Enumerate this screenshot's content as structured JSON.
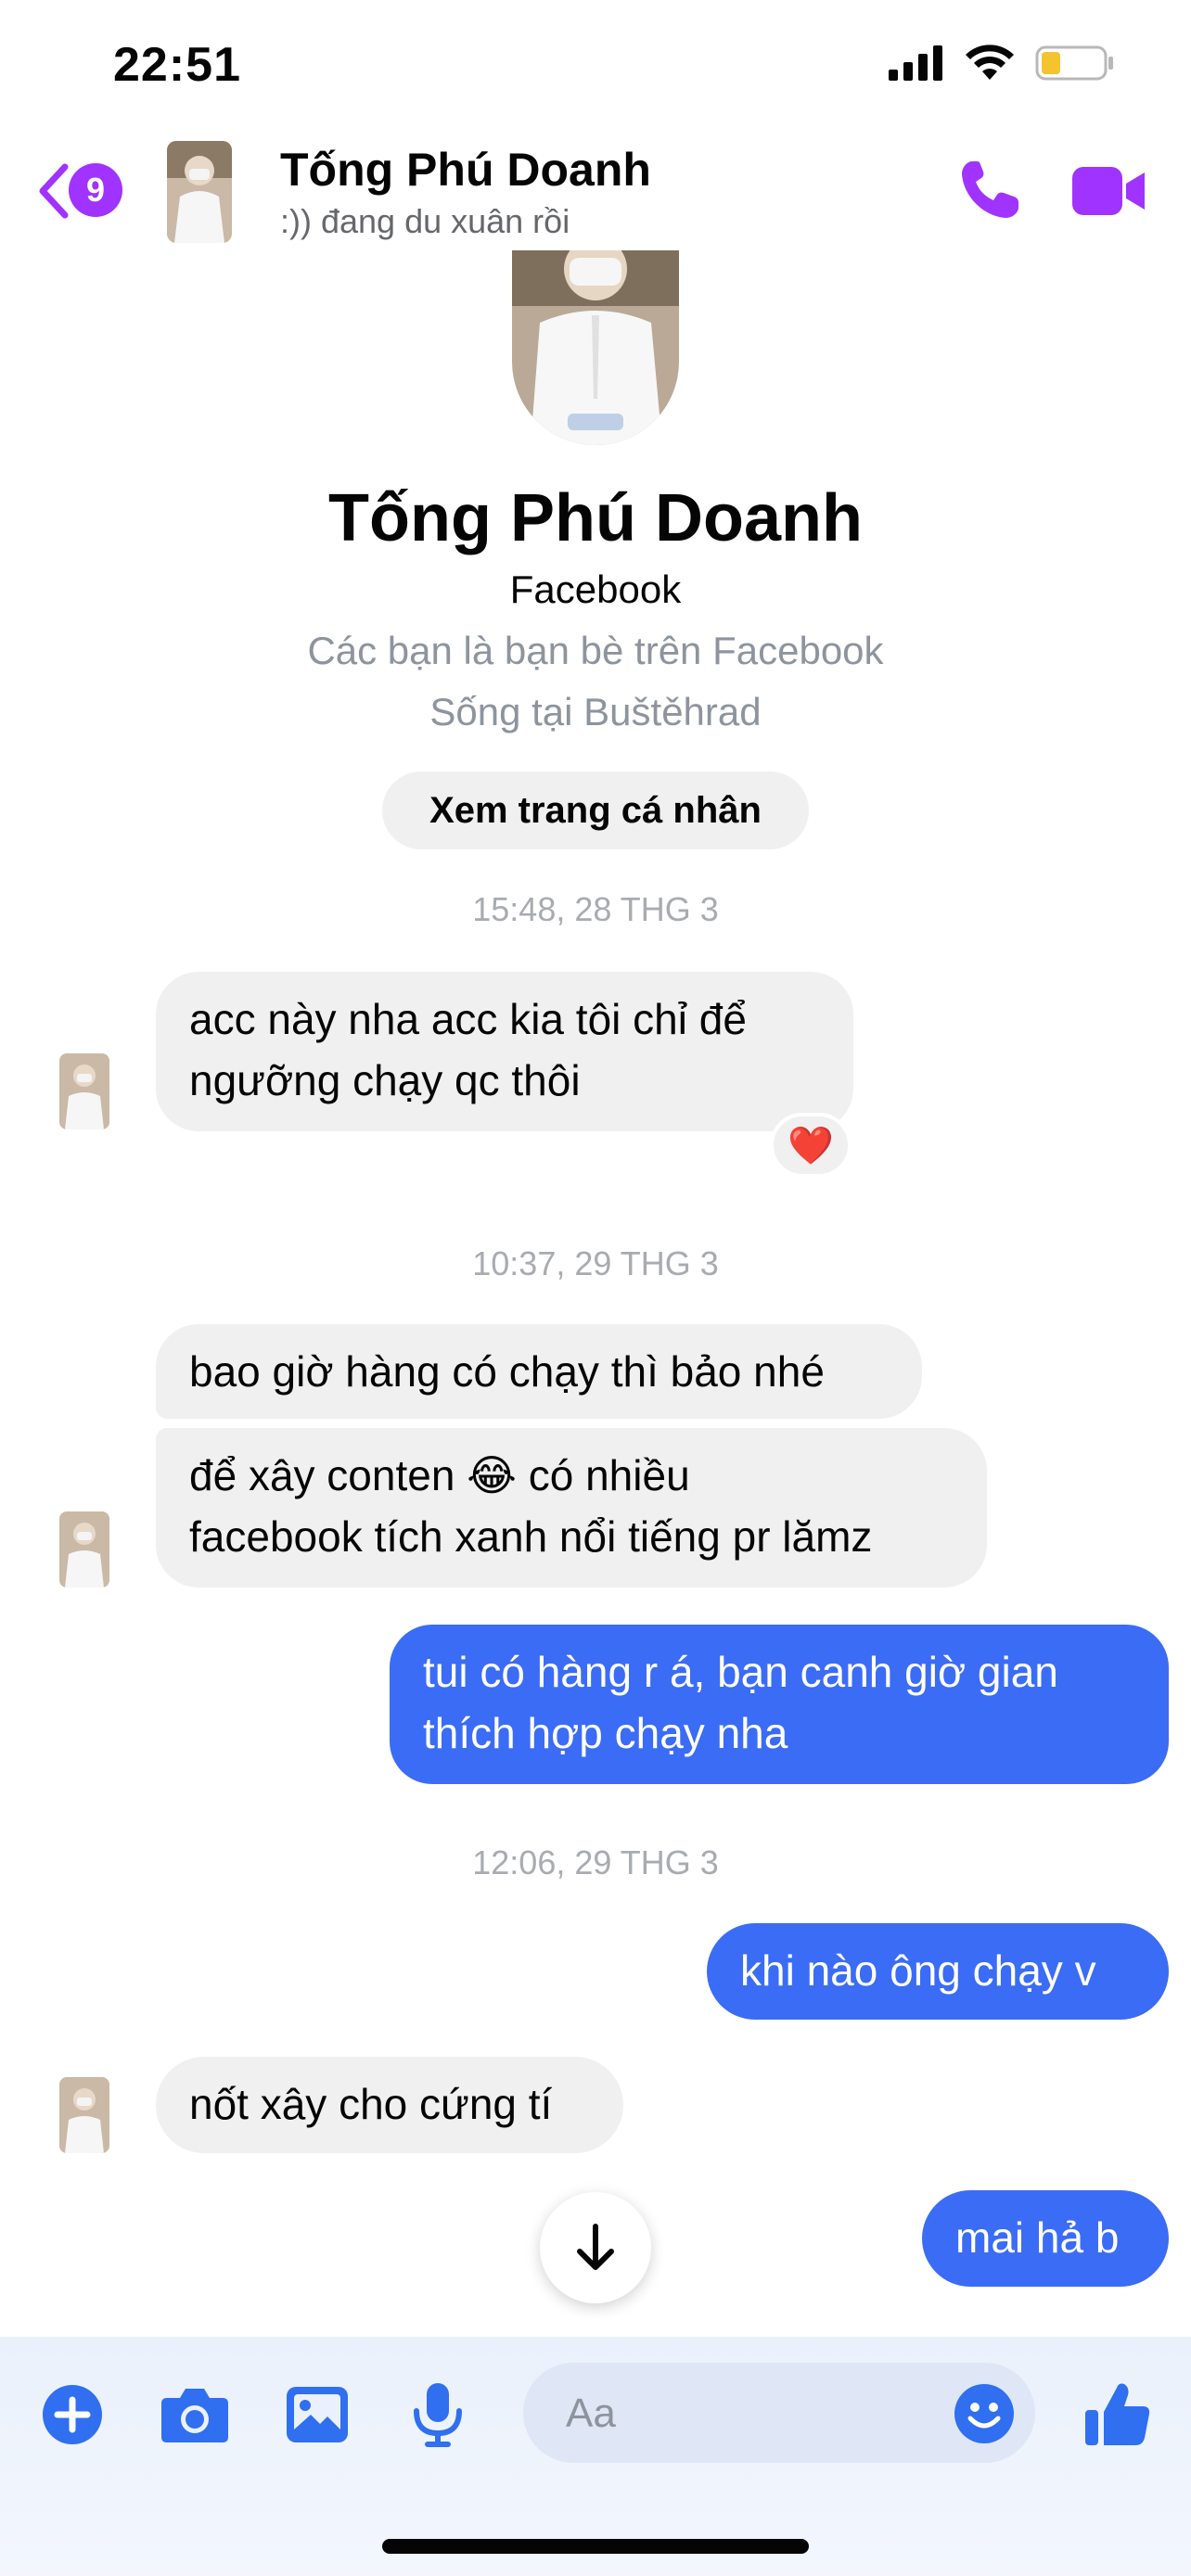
{
  "status_bar": {
    "time": "22:51"
  },
  "header": {
    "back_badge": "9",
    "name": "Tống Phú Doanh",
    "status": ":)) đang du xuân rồi"
  },
  "profile": {
    "name": "Tống Phú Doanh",
    "source": "Facebook",
    "friendship": "Các bạn là bạn bè trên Facebook",
    "location": "Sống tại Buštěhrad",
    "view_profile_label": "Xem trang cá nhân"
  },
  "conversation": {
    "timestamps": [
      "15:48, 28 THG 3",
      "10:37, 29 THG 3",
      "12:06, 29 THG 3"
    ],
    "messages": [
      {
        "sender": "them",
        "lines": [
          "acc này nha acc kia tôi chỉ để",
          "ngưỡng chạy qc thôi"
        ],
        "reaction": "❤️"
      },
      {
        "sender": "them",
        "lines": [
          "bao giờ hàng có chạy thì bảo nhé"
        ]
      },
      {
        "sender": "them",
        "lines": [
          "để xây conten 😂 có nhiều",
          "facebook tích xanh nổi tiếng pr lămz"
        ]
      },
      {
        "sender": "me",
        "lines": [
          "tui có hàng r á, bạn canh giờ gian",
          "thích hợp chạy nha"
        ]
      },
      {
        "sender": "me",
        "lines": [
          "khi nào ông chạy v"
        ]
      },
      {
        "sender": "them",
        "lines": [
          "nốt xây cho cứng tí"
        ]
      },
      {
        "sender": "me",
        "lines": [
          "mai hả b"
        ]
      }
    ]
  },
  "composer": {
    "placeholder": "Aa"
  },
  "colors": {
    "accent_purple": "#a033ff",
    "outgoing_bubble": "#3b6cf6",
    "incoming_bubble": "#f0f0f0",
    "composer_icon_blue": "#2f6ff0"
  },
  "icons": [
    "back-chevron-icon",
    "phone-icon",
    "video-camera-icon",
    "arrow-down-icon",
    "plus-icon",
    "camera-icon",
    "gallery-icon",
    "microphone-icon",
    "emoji-icon",
    "thumbs-up-icon"
  ]
}
